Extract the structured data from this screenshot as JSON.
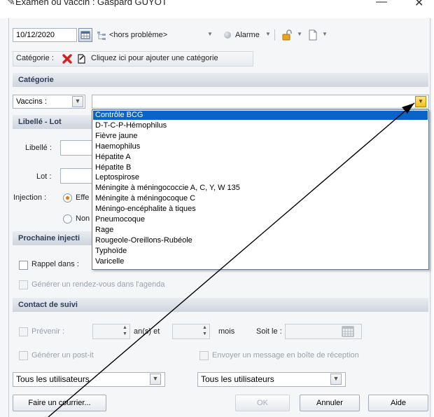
{
  "window": {
    "title": "Examen ou vaccin : Gaspard GUYOT",
    "minimize_glyph": "—",
    "close_glyph": "✕"
  },
  "toolbar": {
    "date_value": "10/12/2020",
    "status_value": "<hors problème>",
    "alarm_label": "Alarme"
  },
  "category_bar": {
    "label": "Catégorie :",
    "add_link": "Cliquez ici pour ajouter une catégorie"
  },
  "sections": {
    "categorie": "Catégorie",
    "libelle_lot": "Libellé - Lot",
    "prochaine_injection": "Prochaine injecti",
    "contact_suivi": "Contact de suivi"
  },
  "categorie": {
    "type_value": "Vaccins :",
    "vaccine_value": ""
  },
  "libelle_lot": {
    "libelle_label": "Libellé :",
    "lot_label": "Lot :",
    "injection_label": "Injection :",
    "radio_effectuee": "Effe",
    "radio_non": "Non"
  },
  "prochaine": {
    "rappel_label": "Rappel dans :",
    "rdv_label": "Générer un rendez-vous dans l'agenda"
  },
  "contact": {
    "prevenir_label": "Prévenir :",
    "ans_label": "an(s) et",
    "mois_label": "mois",
    "soit_le_label": "Soit le :",
    "postit_label": "Générer un post-it",
    "message_label": "Envoyer un message en boîte de réception",
    "users_left": "Tous les utilisateurs",
    "users_right": "Tous les utilisateurs"
  },
  "buttons": {
    "courrier": "Faire un courrier...",
    "ok": "OK",
    "annuler": "Annuler",
    "aide": "Aide"
  },
  "vaccine_dropdown": {
    "selected_index": 0,
    "items": [
      "Contrôle BCG",
      "D-T-C-P-Hémophilus",
      "Fièvre jaune",
      "Haemophilus",
      "Hépatite A",
      "Hépatite B",
      "Leptospirose",
      "Méningite à méningococcie A, C, Y, W 135",
      "Méningite à méningocoque C",
      "Méningo-encéphalite à tiques",
      "Pneumocoque",
      "Rage",
      "Rougeole-Oreillons-Rubéole",
      "Typhoïde",
      "Varicelle"
    ]
  },
  "colors": {
    "selection": "#0a64c8",
    "section_text": "#2c3e57",
    "dropdown_button": "#f0c020",
    "delete_icon": "#d62020"
  }
}
